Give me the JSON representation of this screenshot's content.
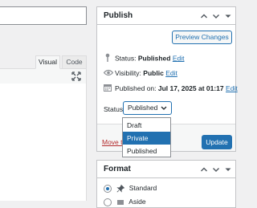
{
  "editor": {
    "tabs": [
      {
        "label": "Visual"
      },
      {
        "label": "Code"
      }
    ]
  },
  "publish": {
    "title": "Publish",
    "preview_label": "Preview Changes",
    "status": {
      "label": "Status:",
      "value": "Published",
      "edit": "Edit"
    },
    "visibility": {
      "label": "Visibility:",
      "value": "Public",
      "edit": "Edit"
    },
    "published_on": {
      "label": "Published on:",
      "value": "Jul 17, 2025 at 01:17",
      "edit": "Edit"
    },
    "status_select": {
      "label": "Status:",
      "value": "Published"
    },
    "dropdown_options": [
      "Draft",
      "Private",
      "Published"
    ],
    "dropdown_highlighted": "Private",
    "move_trash": "Move to Trash",
    "update_label": "Update"
  },
  "format": {
    "title": "Format",
    "options": [
      "Standard",
      "Aside"
    ],
    "selected": "Standard"
  },
  "colors": {
    "accent": "#2271b1",
    "trash": "#b32d2e",
    "background": "#f0f0f1"
  }
}
